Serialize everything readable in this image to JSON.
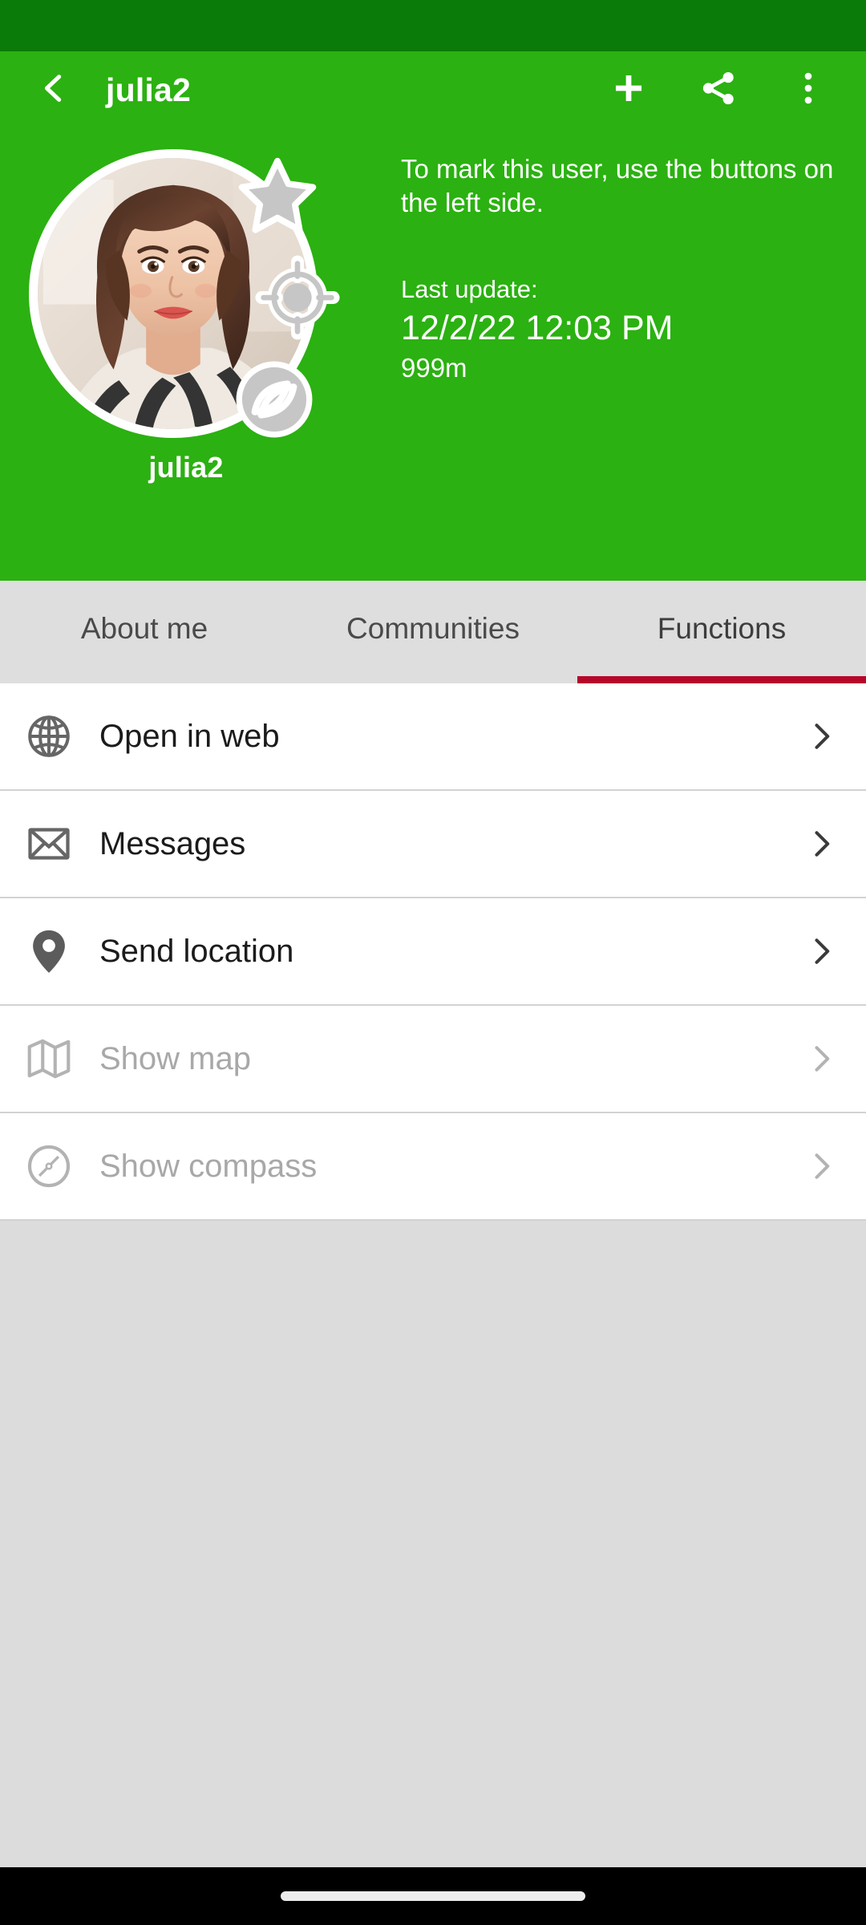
{
  "app_bar": {
    "title": "julia2",
    "back_icon": "chevron-left-icon",
    "actions": [
      {
        "name": "add-button",
        "icon": "plus-icon"
      },
      {
        "name": "share-button",
        "icon": "share-icon"
      },
      {
        "name": "overflow-button",
        "icon": "more-vertical-icon"
      }
    ]
  },
  "profile": {
    "username": "julia2",
    "avatar_alt": "julia2-profile-photo",
    "badges": [
      {
        "name": "favorite-badge",
        "icon": "star-icon"
      },
      {
        "name": "target-badge",
        "icon": "crosshair-icon"
      },
      {
        "name": "block-badge",
        "icon": "blocked-icon"
      }
    ],
    "note": "To mark this user, use the buttons on the left side.",
    "last_update_label": "Last update:",
    "last_update_value": "12/2/22 12:03 PM",
    "distance": "999m"
  },
  "tabs": {
    "active_index": 2,
    "items": [
      {
        "label": "About me"
      },
      {
        "label": "Communities"
      },
      {
        "label": "Functions"
      }
    ]
  },
  "functions_list": [
    {
      "label": "Open in web",
      "icon": "globe-icon",
      "enabled": true
    },
    {
      "label": "Messages",
      "icon": "envelope-icon",
      "enabled": true
    },
    {
      "label": "Send location",
      "icon": "map-pin-icon",
      "enabled": true
    },
    {
      "label": "Show map",
      "icon": "map-icon",
      "enabled": false
    },
    {
      "label": "Show compass",
      "icon": "compass-icon",
      "enabled": false
    }
  ],
  "colors": {
    "status_bar": "#0A7A09",
    "app_bar": "#2BB111",
    "tab_bar": "#DEDEDE",
    "tab_indicator": "#B5072B",
    "page_background": "#DCDCDC",
    "list_background": "#FFFFFF",
    "nav_bar": "#000000"
  }
}
